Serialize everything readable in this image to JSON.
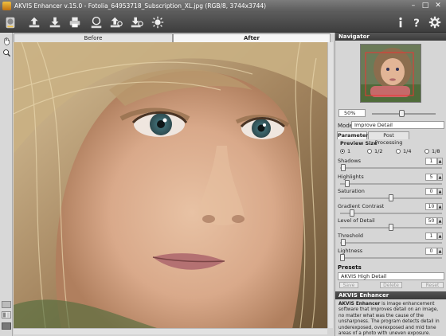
{
  "window": {
    "title": "AKVIS Enhancer v.15.0 - Fotolia_64953718_Subscription_XL.jpg (RGB/8, 3744x3744)",
    "minimize": "–",
    "maximize": "□",
    "close": "✕"
  },
  "view_tabs": {
    "before": "Before",
    "after": "After"
  },
  "navigator": {
    "header": "Navigator",
    "zoom": "50%"
  },
  "mode": {
    "label": "Mode:",
    "value": "Improve Detail"
  },
  "param_tabs": {
    "parameters": "Parameters",
    "post": "Post Processing"
  },
  "preview": {
    "header": "Preview Size",
    "options": [
      "1",
      "1/2",
      "1/4",
      "1/8"
    ],
    "selected": "1"
  },
  "params": [
    {
      "label": "Shadows",
      "value": "1",
      "level": 0.01
    },
    {
      "label": "Highlights",
      "value": "5",
      "level": 0.05
    },
    {
      "label": "Saturation",
      "value": "0",
      "level": 0.5
    },
    {
      "label": "Gradient Contrast",
      "value": "10",
      "level": 0.1
    },
    {
      "label": "Level of Detail",
      "value": "50",
      "level": 0.5
    },
    {
      "label": "Threshold",
      "value": "1",
      "level": 0.01
    },
    {
      "label": "Lightness",
      "value": "0",
      "level": 0.0
    }
  ],
  "presets": {
    "header": "Presets",
    "selected": "AKVIS High Detail",
    "save": "Save",
    "delete": "Delete",
    "reset": "Reset"
  },
  "help": {
    "header": "AKVIS Enhancer",
    "bold": "AKVIS Enhancer",
    "text": " is image enhancement software that improves detail on an image, no matter what was the cause of the unsharpness. The program detects detail in underexposed, overexposed and mid tone areas of a photo with uneven exposure."
  }
}
